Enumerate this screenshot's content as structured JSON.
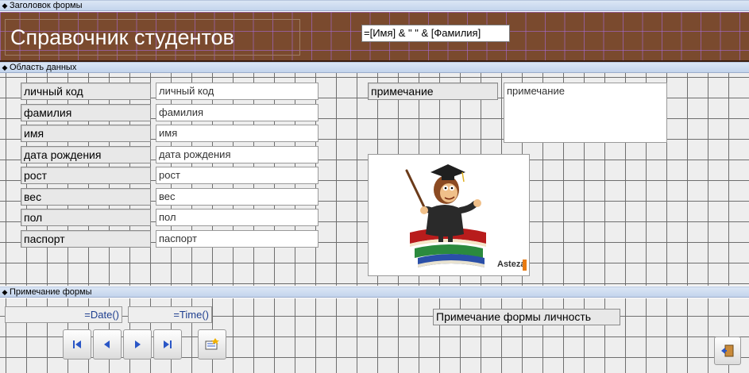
{
  "sections": {
    "header": "Заголовок формы",
    "detail": "Область данных",
    "footer": "Примечание формы"
  },
  "header": {
    "title": "Справочник студентов",
    "formula": "=[Имя] & \" \" & [Фамилия]"
  },
  "fields": [
    {
      "label": "личный код",
      "value": "личный код"
    },
    {
      "label": "фамилия",
      "value": "фамилия"
    },
    {
      "label": "имя",
      "value": "имя"
    },
    {
      "label": "дата рождения",
      "value": "дата рождения"
    },
    {
      "label": "рост",
      "value": "рост"
    },
    {
      "label": "вес",
      "value": "вес"
    },
    {
      "label": "пол",
      "value": "пол"
    },
    {
      "label": "паспорт",
      "value": "паспорт"
    }
  ],
  "note": {
    "label": "примечание",
    "value": "примечание"
  },
  "image": {
    "watermark": "Asteza"
  },
  "footer": {
    "date_expr": "=Date()",
    "time_expr": "=Time()",
    "label": "Примечание формы личность"
  },
  "navigation": {
    "buttons": [
      "first-record",
      "previous-record",
      "next-record",
      "last-record",
      "new-record",
      "exit"
    ]
  },
  "colors": {
    "header_bg": "#7a4a2e",
    "grid_bg": "#eeeeee",
    "accent_text": "#1f3f8f"
  }
}
